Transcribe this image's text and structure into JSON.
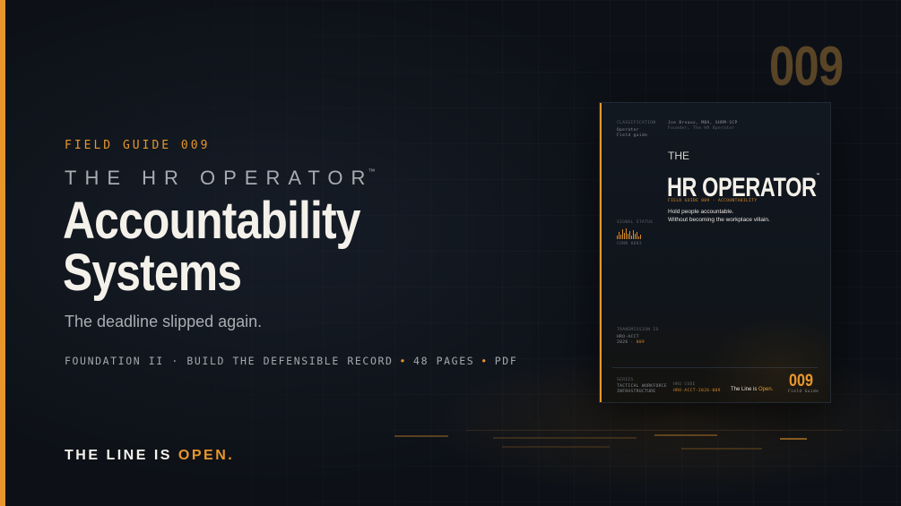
{
  "hero": {
    "eyebrow": "FIELD GUIDE 009",
    "product_name": "THE HR OPERATOR",
    "trademark": "™",
    "headline_line1": "Accountability",
    "headline_line2": "Systems",
    "subline": "The deadline slipped again.",
    "meta": {
      "series": "FOUNDATION II · BUILD THE DEFENSIBLE RECORD",
      "pages": "48 PAGES",
      "format": "PDF"
    },
    "tagline_prefix": "THE LINE IS ",
    "tagline_highlight": "OPEN."
  },
  "issue_number": "009",
  "cover": {
    "classification_label": "CLASSIFICATION",
    "classification_value_1": "Operator",
    "classification_value_2": "Field guide",
    "author": "Joe Breaux, MBA, SHRM-SCP",
    "author_role": "Founder, The HR Operator",
    "title_prefix": "THE",
    "title": "HR OPERATOR",
    "title_trademark": "™",
    "series_line": "FIELD GUIDE 009 · ACCOUNTABILITY",
    "tagline_1": "Hold people accountable.",
    "tagline_2": "Without becoming the workplace villain.",
    "signal_label": "SIGNAL STATUS",
    "signal_value": "CONN 0003",
    "transmission_label": "TRANSMISSION ID",
    "transmission_value_1": "HRO-ACCT",
    "transmission_value_2a": "2026 ·",
    "transmission_value_2b": "009",
    "footer_series_label": "SERIES",
    "footer_series_1": "TACTICAL WORKFORCE",
    "footer_series_2": "INFRASTRUCTURE",
    "footer_code_label": "HRO CODE",
    "footer_code": "HRO-ACCT-2026-009",
    "footer_inline_prefix": "The Line is ",
    "footer_inline_highlight": "Open.",
    "footer_number": "009",
    "footer_number_label": "Field Guide"
  },
  "colors": {
    "accent": "#e8962c",
    "background": "#0d1117",
    "text": "#f4f1ea",
    "muted": "#a9adb4"
  }
}
